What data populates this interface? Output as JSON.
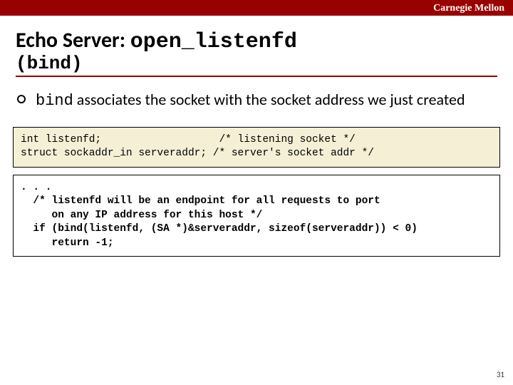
{
  "header": {
    "org": "Carnegie Mellon"
  },
  "title": {
    "prefix": "Echo Server: ",
    "mono": "open_listenfd",
    "subtitle": "(bind)"
  },
  "bullet": {
    "code": "bind",
    "rest": " associates the socket with the socket address we just created"
  },
  "code1": "int listenfd;                   /* listening socket */\nstruct sockaddr_in serveraddr; /* server's socket addr */",
  "code2": ". . .\n  /* listenfd will be an endpoint for all requests to port\n     on any IP address for this host */\n  if (bind(listenfd, (SA *)&serveraddr, sizeof(serveraddr)) < 0)\n     return -1;",
  "page": "31"
}
